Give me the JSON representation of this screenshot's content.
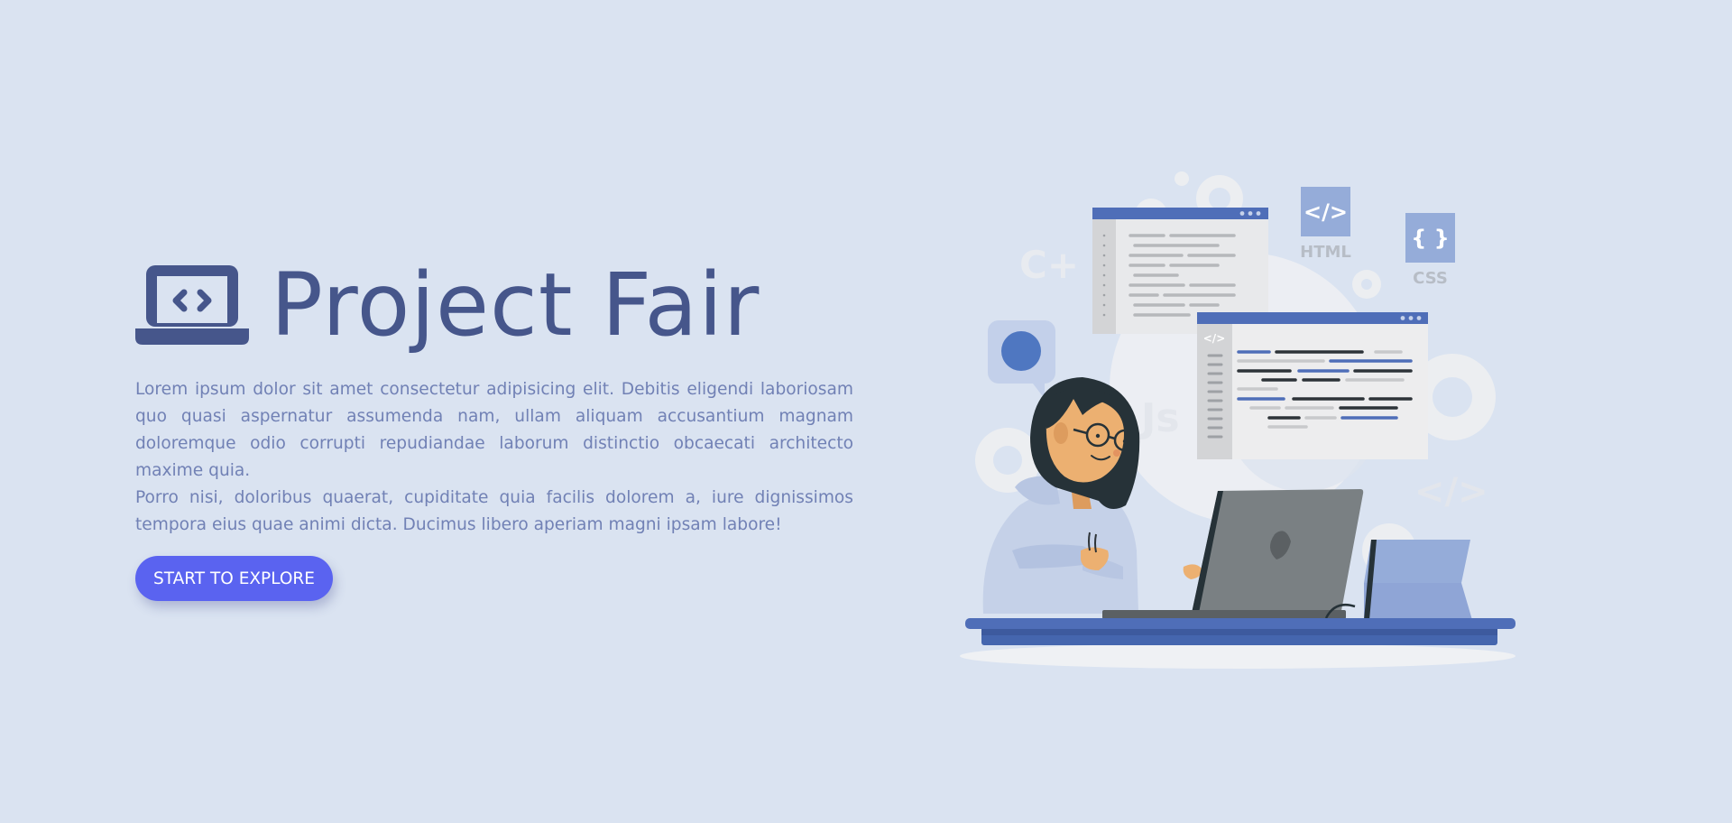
{
  "hero": {
    "title": "Project Fair",
    "paragraph_1": "Lorem ipsum dolor sit amet consectetur adipisicing elit. Debitis eligendi laboriosam quo quasi aspernatur assumenda nam, ullam aliquam accusantium magnam doloremque odio corrupti repudiandae laborum distinctio obcaecati architecto maxime quia.",
    "paragraph_2": "Porro nisi, doloribus quaerat, cupiditate quia facilis dolorem a, iure dignissimos tempora eius quae animi dicta. Ducimus libero aperiam magni ipsam labore!",
    "cta_label": "START TO EXPLORE",
    "logo_icon": "laptop-code-icon"
  },
  "illustration": {
    "html_label": "HTML",
    "css_label": "CSS",
    "html_badge_text": "</>",
    "css_badge_text": "{ }",
    "code_window_tag": "</>",
    "bg_c_text": "C+",
    "bg_js_text": "Js",
    "bg_tag_text": "</>"
  },
  "colors": {
    "background": "#dae3f1",
    "title": "#46568b",
    "body_text": "#7181b5",
    "button": "#5a63f0",
    "accent_blue": "#4f6eb8",
    "badge_blue": "#8fa5d6"
  }
}
